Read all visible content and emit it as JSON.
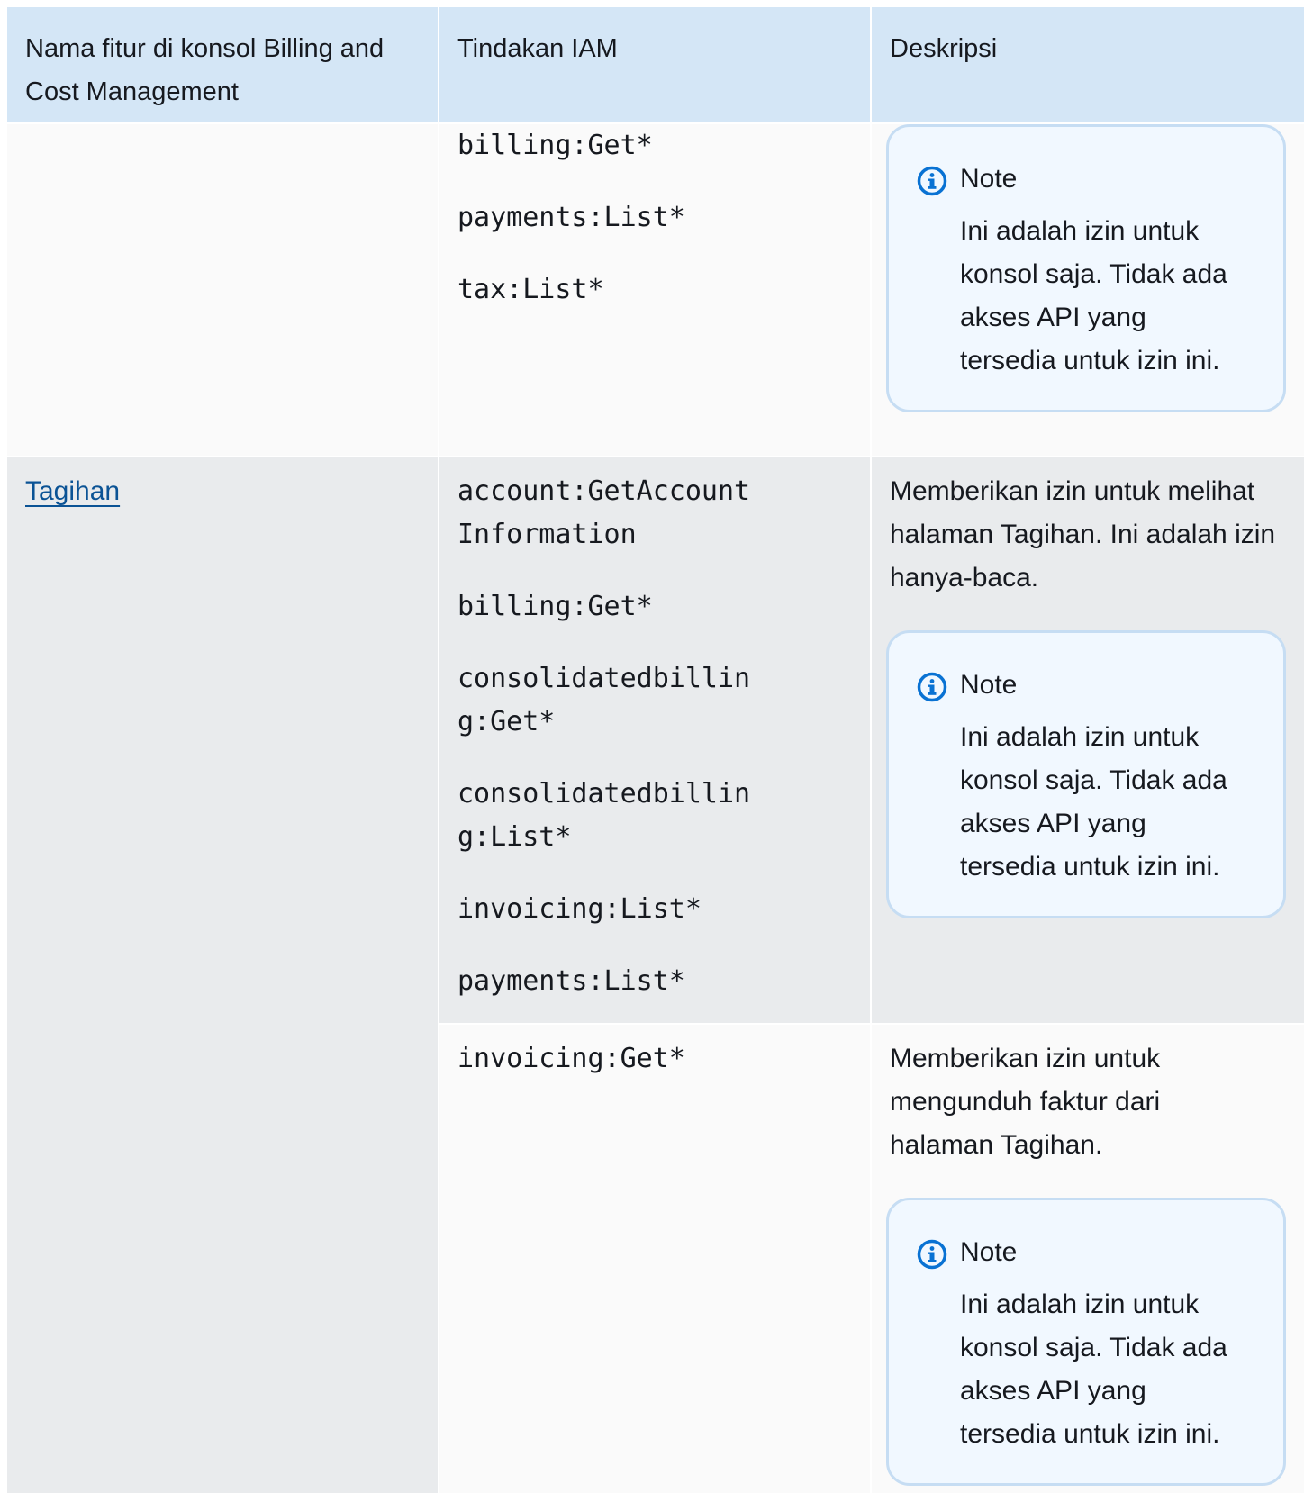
{
  "table": {
    "headers": [
      "Nama fitur di konsol Billing and Cost Management",
      "Tindakan IAM",
      "Deskripsi"
    ],
    "rows": [
      {
        "feature": "",
        "actions": [
          "billing:Get*",
          "payments:List*",
          "tax:List*"
        ],
        "description": "",
        "note": {
          "title": "Note",
          "body": "Ini adalah izin untuk konsol saja. Tidak ada akses API yang tersedia untuk izin ini."
        }
      },
      {
        "feature": "Tagihan",
        "actions": [
          "account:GetAccount\nInformation",
          "billing:Get*",
          "consolidatedbillin\ng:Get*",
          "consolidatedbillin\ng:List*",
          "invoicing:List*",
          "payments:List*"
        ],
        "description": "Memberikan izin untuk melihat halaman Tagihan. Ini adalah izin hanya-baca.",
        "note": {
          "title": "Note",
          "body": "Ini adalah izin untuk konsol saja. Tidak ada akses API yang tersedia untuk izin ini."
        }
      },
      {
        "feature": "",
        "actions": [
          "invoicing:Get*"
        ],
        "description": "Memberikan izin untuk mengunduh faktur dari halaman Tagihan.",
        "note": {
          "title": "Note",
          "body": "Ini adalah izin untuk konsol saja. Tidak ada akses API yang tersedia untuk izin ini."
        }
      }
    ]
  },
  "icons": {
    "note": "info-circle-icon"
  },
  "colors": {
    "header_bg": "#d4e6f6",
    "row_light": "#fafafa",
    "row_gray": "#e9ebed",
    "link": "#0b5395",
    "note_bg": "#f1f8ff",
    "note_border": "#c6ddf3",
    "icon": "#0972d3"
  }
}
